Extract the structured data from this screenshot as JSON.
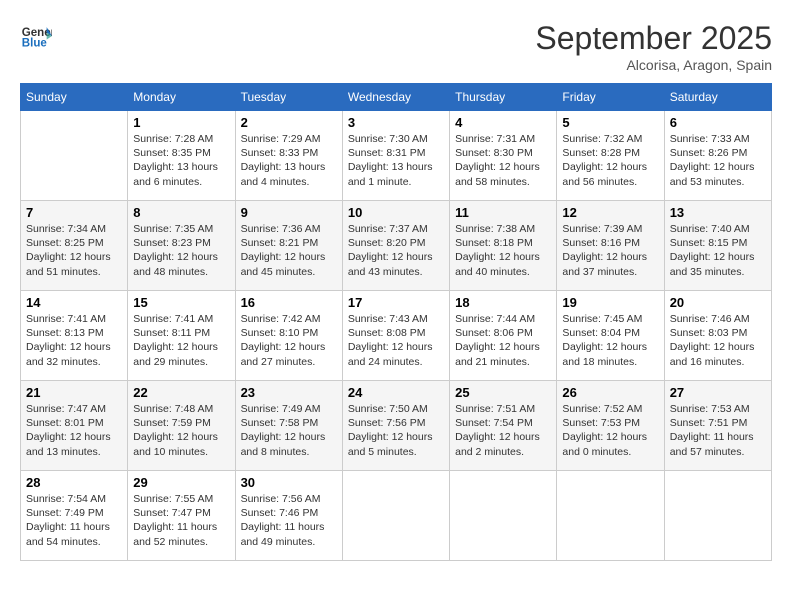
{
  "header": {
    "logo_line1": "General",
    "logo_line2": "Blue",
    "month_title": "September 2025",
    "location": "Alcorisa, Aragon, Spain"
  },
  "days_of_week": [
    "Sunday",
    "Monday",
    "Tuesday",
    "Wednesday",
    "Thursday",
    "Friday",
    "Saturday"
  ],
  "weeks": [
    [
      {
        "day": null
      },
      {
        "day": "1",
        "sunrise": "Sunrise: 7:28 AM",
        "sunset": "Sunset: 8:35 PM",
        "daylight": "Daylight: 13 hours and 6 minutes."
      },
      {
        "day": "2",
        "sunrise": "Sunrise: 7:29 AM",
        "sunset": "Sunset: 8:33 PM",
        "daylight": "Daylight: 13 hours and 4 minutes."
      },
      {
        "day": "3",
        "sunrise": "Sunrise: 7:30 AM",
        "sunset": "Sunset: 8:31 PM",
        "daylight": "Daylight: 13 hours and 1 minute."
      },
      {
        "day": "4",
        "sunrise": "Sunrise: 7:31 AM",
        "sunset": "Sunset: 8:30 PM",
        "daylight": "Daylight: 12 hours and 58 minutes."
      },
      {
        "day": "5",
        "sunrise": "Sunrise: 7:32 AM",
        "sunset": "Sunset: 8:28 PM",
        "daylight": "Daylight: 12 hours and 56 minutes."
      },
      {
        "day": "6",
        "sunrise": "Sunrise: 7:33 AM",
        "sunset": "Sunset: 8:26 PM",
        "daylight": "Daylight: 12 hours and 53 minutes."
      }
    ],
    [
      {
        "day": "7",
        "sunrise": "Sunrise: 7:34 AM",
        "sunset": "Sunset: 8:25 PM",
        "daylight": "Daylight: 12 hours and 51 minutes."
      },
      {
        "day": "8",
        "sunrise": "Sunrise: 7:35 AM",
        "sunset": "Sunset: 8:23 PM",
        "daylight": "Daylight: 12 hours and 48 minutes."
      },
      {
        "day": "9",
        "sunrise": "Sunrise: 7:36 AM",
        "sunset": "Sunset: 8:21 PM",
        "daylight": "Daylight: 12 hours and 45 minutes."
      },
      {
        "day": "10",
        "sunrise": "Sunrise: 7:37 AM",
        "sunset": "Sunset: 8:20 PM",
        "daylight": "Daylight: 12 hours and 43 minutes."
      },
      {
        "day": "11",
        "sunrise": "Sunrise: 7:38 AM",
        "sunset": "Sunset: 8:18 PM",
        "daylight": "Daylight: 12 hours and 40 minutes."
      },
      {
        "day": "12",
        "sunrise": "Sunrise: 7:39 AM",
        "sunset": "Sunset: 8:16 PM",
        "daylight": "Daylight: 12 hours and 37 minutes."
      },
      {
        "day": "13",
        "sunrise": "Sunrise: 7:40 AM",
        "sunset": "Sunset: 8:15 PM",
        "daylight": "Daylight: 12 hours and 35 minutes."
      }
    ],
    [
      {
        "day": "14",
        "sunrise": "Sunrise: 7:41 AM",
        "sunset": "Sunset: 8:13 PM",
        "daylight": "Daylight: 12 hours and 32 minutes."
      },
      {
        "day": "15",
        "sunrise": "Sunrise: 7:41 AM",
        "sunset": "Sunset: 8:11 PM",
        "daylight": "Daylight: 12 hours and 29 minutes."
      },
      {
        "day": "16",
        "sunrise": "Sunrise: 7:42 AM",
        "sunset": "Sunset: 8:10 PM",
        "daylight": "Daylight: 12 hours and 27 minutes."
      },
      {
        "day": "17",
        "sunrise": "Sunrise: 7:43 AM",
        "sunset": "Sunset: 8:08 PM",
        "daylight": "Daylight: 12 hours and 24 minutes."
      },
      {
        "day": "18",
        "sunrise": "Sunrise: 7:44 AM",
        "sunset": "Sunset: 8:06 PM",
        "daylight": "Daylight: 12 hours and 21 minutes."
      },
      {
        "day": "19",
        "sunrise": "Sunrise: 7:45 AM",
        "sunset": "Sunset: 8:04 PM",
        "daylight": "Daylight: 12 hours and 18 minutes."
      },
      {
        "day": "20",
        "sunrise": "Sunrise: 7:46 AM",
        "sunset": "Sunset: 8:03 PM",
        "daylight": "Daylight: 12 hours and 16 minutes."
      }
    ],
    [
      {
        "day": "21",
        "sunrise": "Sunrise: 7:47 AM",
        "sunset": "Sunset: 8:01 PM",
        "daylight": "Daylight: 12 hours and 13 minutes."
      },
      {
        "day": "22",
        "sunrise": "Sunrise: 7:48 AM",
        "sunset": "Sunset: 7:59 PM",
        "daylight": "Daylight: 12 hours and 10 minutes."
      },
      {
        "day": "23",
        "sunrise": "Sunrise: 7:49 AM",
        "sunset": "Sunset: 7:58 PM",
        "daylight": "Daylight: 12 hours and 8 minutes."
      },
      {
        "day": "24",
        "sunrise": "Sunrise: 7:50 AM",
        "sunset": "Sunset: 7:56 PM",
        "daylight": "Daylight: 12 hours and 5 minutes."
      },
      {
        "day": "25",
        "sunrise": "Sunrise: 7:51 AM",
        "sunset": "Sunset: 7:54 PM",
        "daylight": "Daylight: 12 hours and 2 minutes."
      },
      {
        "day": "26",
        "sunrise": "Sunrise: 7:52 AM",
        "sunset": "Sunset: 7:53 PM",
        "daylight": "Daylight: 12 hours and 0 minutes."
      },
      {
        "day": "27",
        "sunrise": "Sunrise: 7:53 AM",
        "sunset": "Sunset: 7:51 PM",
        "daylight": "Daylight: 11 hours and 57 minutes."
      }
    ],
    [
      {
        "day": "28",
        "sunrise": "Sunrise: 7:54 AM",
        "sunset": "Sunset: 7:49 PM",
        "daylight": "Daylight: 11 hours and 54 minutes."
      },
      {
        "day": "29",
        "sunrise": "Sunrise: 7:55 AM",
        "sunset": "Sunset: 7:47 PM",
        "daylight": "Daylight: 11 hours and 52 minutes."
      },
      {
        "day": "30",
        "sunrise": "Sunrise: 7:56 AM",
        "sunset": "Sunset: 7:46 PM",
        "daylight": "Daylight: 11 hours and 49 minutes."
      },
      {
        "day": null
      },
      {
        "day": null
      },
      {
        "day": null
      },
      {
        "day": null
      }
    ]
  ]
}
